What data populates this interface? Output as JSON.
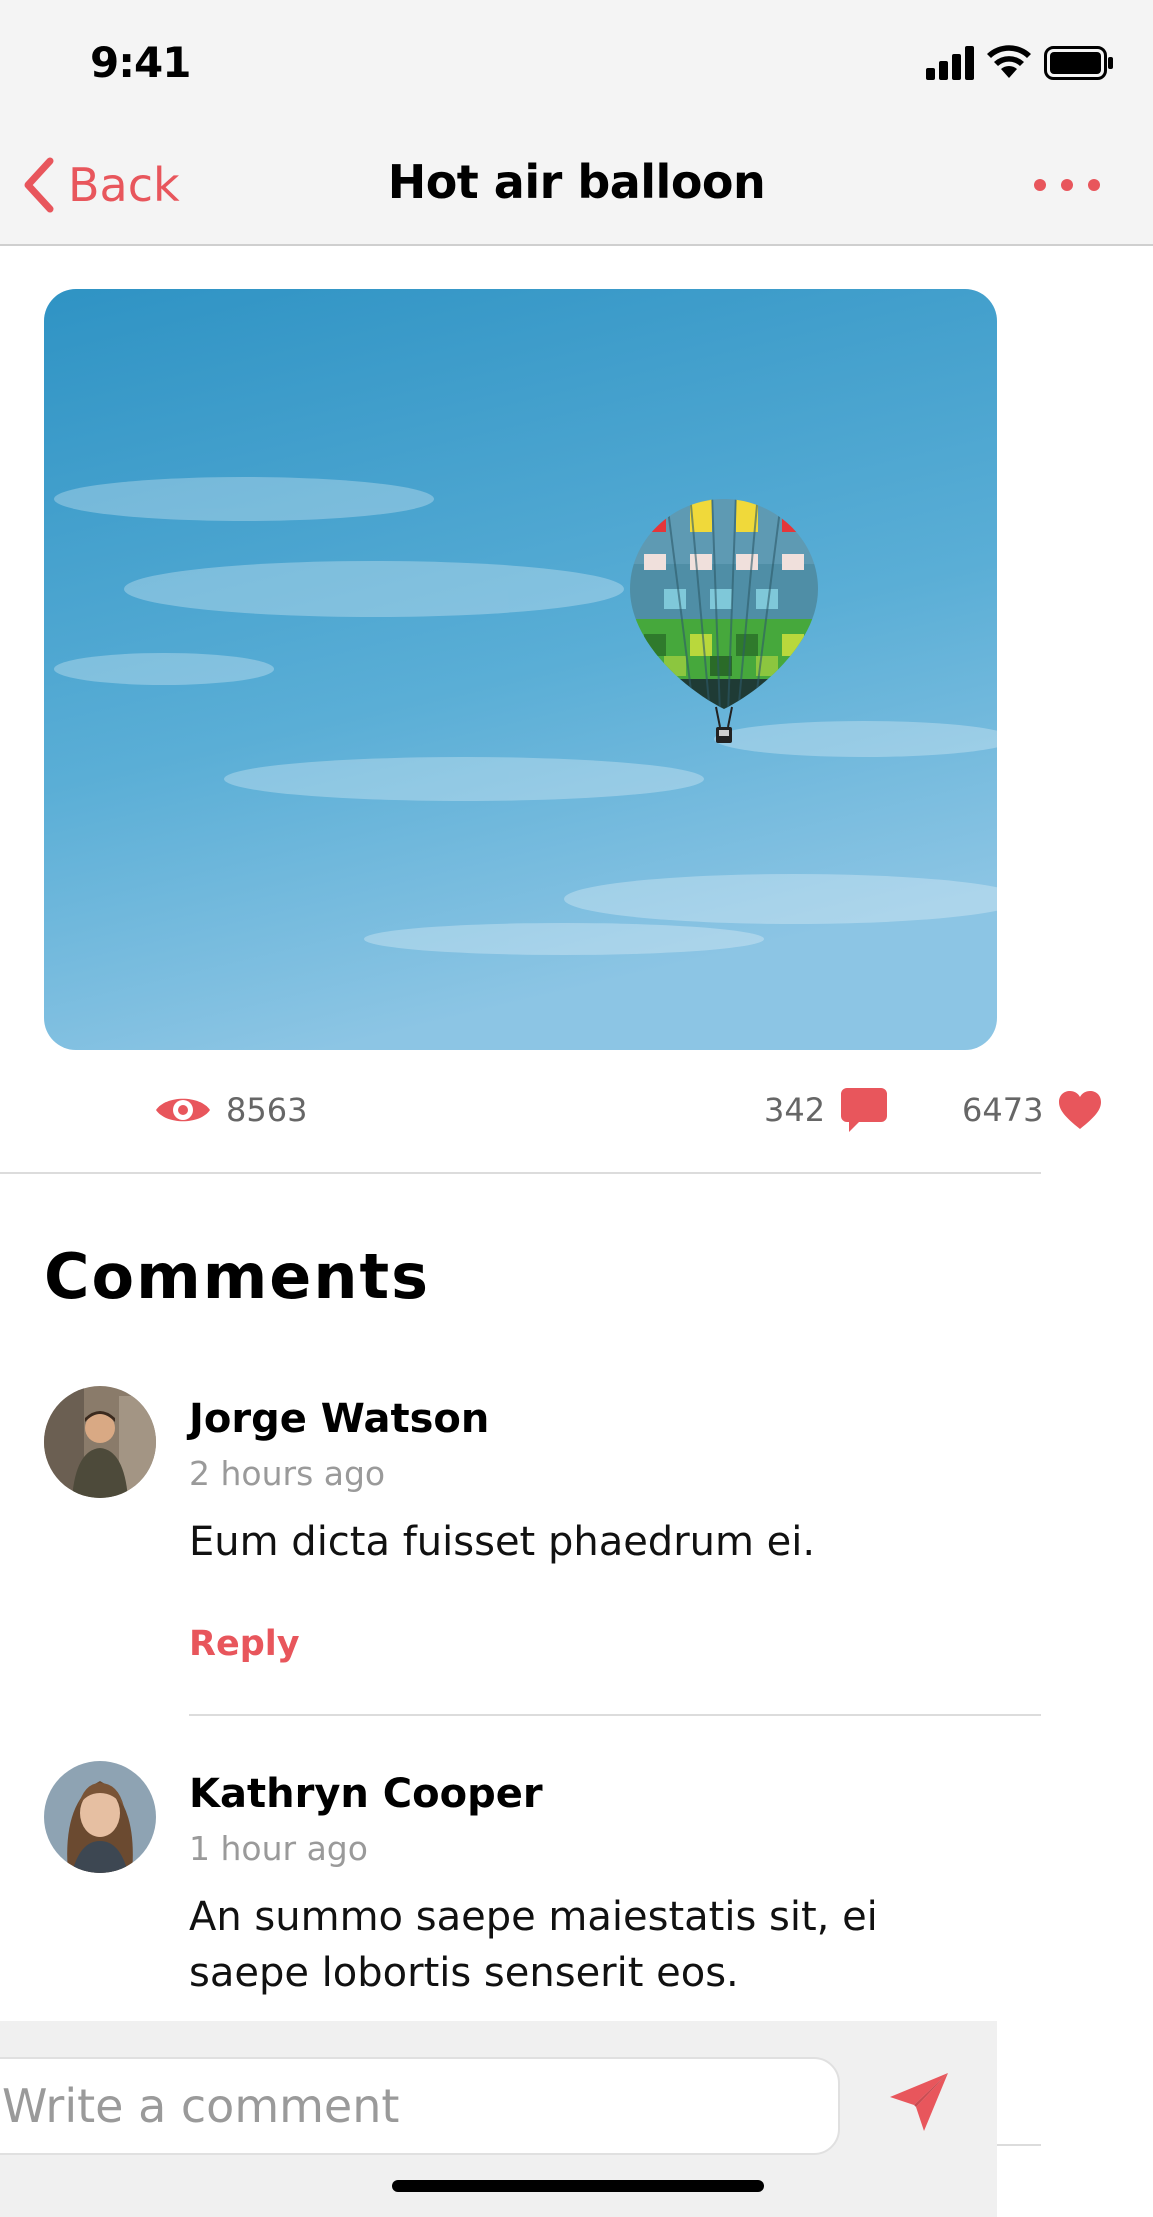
{
  "status_bar": {
    "time": "9:41"
  },
  "nav": {
    "back_label": "Back",
    "title": "Hot air balloon",
    "accent_color": "#e8565c"
  },
  "post": {
    "image_icon": "hot-air-balloon-photo",
    "views": "8563",
    "comments_count": "342",
    "likes": "6473"
  },
  "comments_section": {
    "heading": "Comments",
    "items": [
      {
        "name": "Jorge Watson",
        "time": "2 hours ago",
        "text": "Eum dicta fuisset phaedrum ei.",
        "reply_label": "Reply"
      },
      {
        "name": "Kathryn Cooper",
        "time": "1 hour ago",
        "text": "An summo saepe maiestatis sit, ei saepe lobortis senserit eos."
      }
    ]
  },
  "composer": {
    "placeholder": "Write a comment"
  }
}
